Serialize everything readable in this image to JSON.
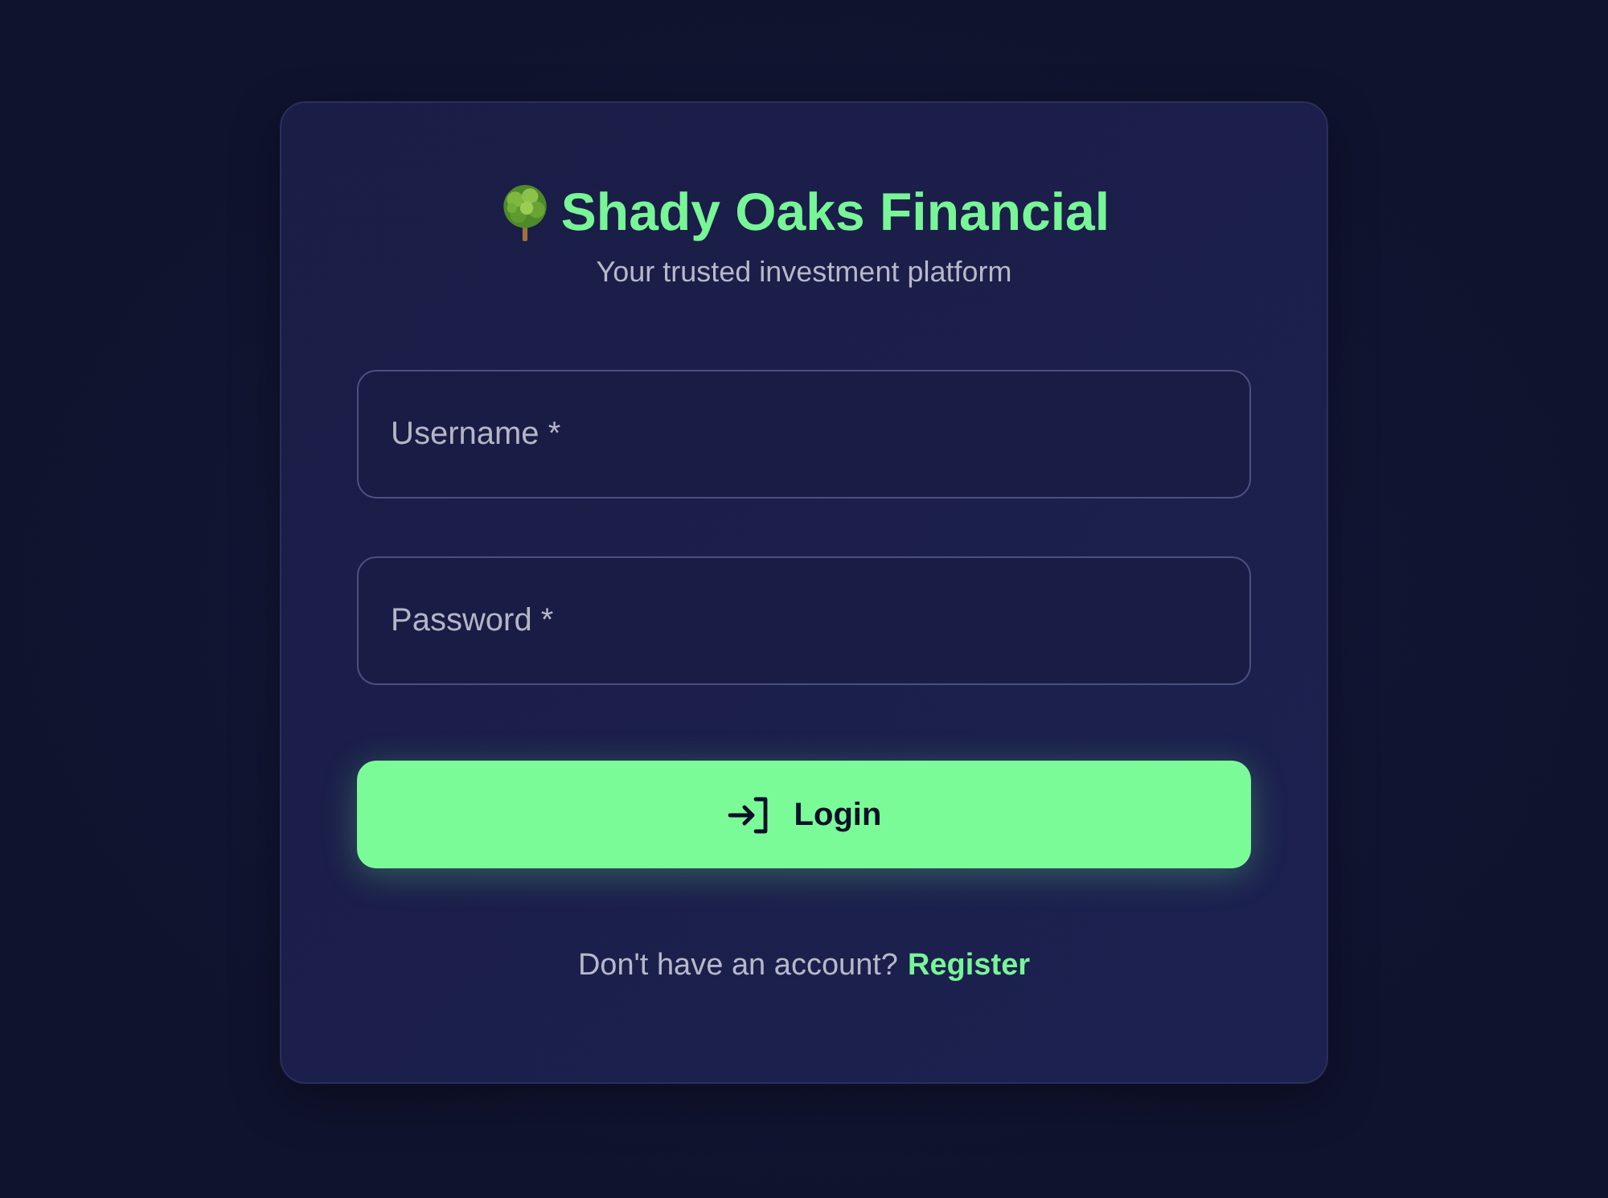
{
  "brand": {
    "title": "Shady Oaks Financial",
    "subtitle": "Your trusted investment platform"
  },
  "fields": [
    {
      "placeholder": "Username *"
    },
    {
      "placeholder": "Password *"
    }
  ],
  "submit": {
    "label": "Login"
  },
  "footer": {
    "text": "Don't have an account?",
    "link": "Register"
  }
}
